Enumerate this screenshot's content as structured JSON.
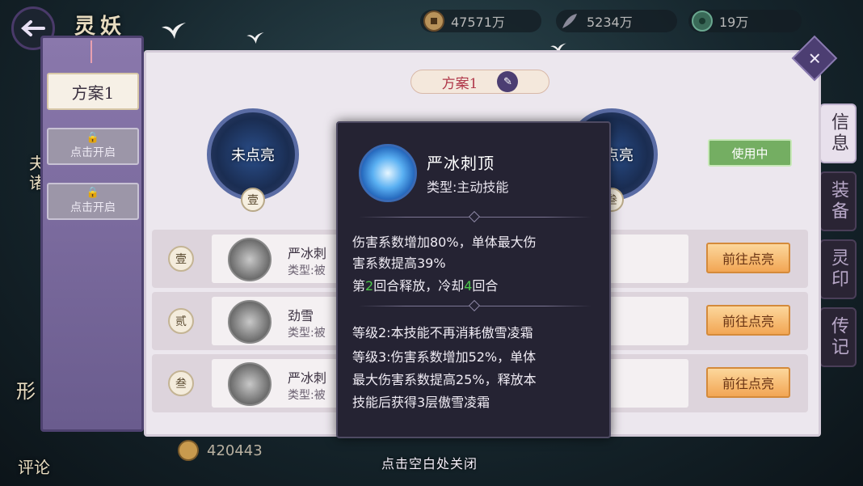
{
  "header": {
    "title": "灵妖",
    "currencies": [
      {
        "icon": "copper-coin-icon",
        "value": "47571万"
      },
      {
        "icon": "feather-icon",
        "value": "5234万"
      },
      {
        "icon": "jade-icon",
        "value": "19万"
      }
    ]
  },
  "side_tabs": [
    {
      "label": "信息",
      "active": true
    },
    {
      "label": "装备",
      "active": false
    },
    {
      "label": "灵印",
      "active": false
    },
    {
      "label": "传记",
      "active": false
    }
  ],
  "left_edge": {
    "chars_top": "夫诸",
    "chars_bottom_1": "形",
    "chars_bottom_2": "评论"
  },
  "schemes": {
    "active_label": "方案1",
    "locked": [
      {
        "label": "点击开启"
      },
      {
        "label": "点击开启"
      }
    ]
  },
  "panel": {
    "scheme_title": "方案1",
    "status_badge": "使用中",
    "slots": [
      {
        "label": "未点亮",
        "number": "壹"
      },
      {
        "label": "未点亮",
        "number": "叁"
      }
    ],
    "rows": [
      {
        "number": "壹",
        "name": "严冰刺",
        "type": "类型:被",
        "hint": "!",
        "button": "前往点亮"
      },
      {
        "number": "贰",
        "name": "劲雪",
        "type": "类型:被",
        "hint": "!",
        "button": "前往点亮"
      },
      {
        "number": "叁",
        "name": "严冰刺",
        "type": "类型:被",
        "hint": "!",
        "button": "前往点亮"
      }
    ],
    "bottom_currency": "420443"
  },
  "tooltip": {
    "name": "严冰刺顶",
    "type": "类型:主动技能",
    "effect_1": "伤害系数增加80%，单体最大伤",
    "effect_2": "害系数提高39%",
    "release_prefix": "第",
    "release_round": "2",
    "release_mid": "回合释放，冷却",
    "cooldown": "4",
    "release_suffix": "回合",
    "level2": "等级2:本技能不再消耗傲雪凌霜",
    "level3_1": "等级3:伤害系数增加52%，单体",
    "level3_2": "最大伤害系数提高25%，释放本",
    "level3_3": "技能后获得3层傲雪凌霜"
  },
  "close_hint": "点击空白处关闭",
  "colors": {
    "accent_green": "#4cc84a",
    "button_orange": "#f2a654",
    "badge_green": "#74ae62",
    "title_red": "#b0384a"
  }
}
